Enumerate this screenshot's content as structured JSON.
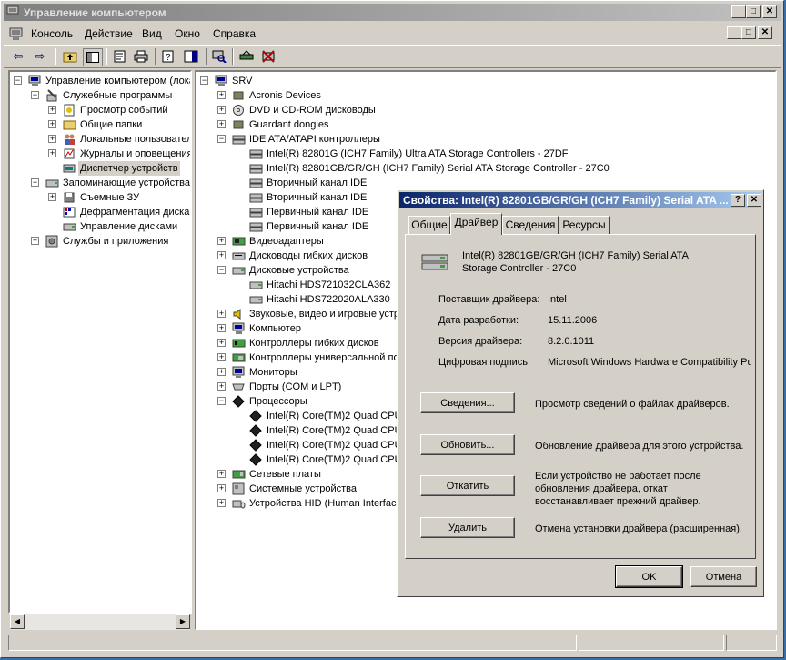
{
  "window": {
    "title": "Управление компьютером",
    "controls": {
      "minimize": "_",
      "maximize": "□",
      "close": "✕"
    }
  },
  "menubar": {
    "items": [
      "Консоль",
      "Действие",
      "Вид",
      "Окно",
      "Справка"
    ]
  },
  "left_tree": [
    {
      "label": "Управление компьютером (локаль",
      "depth": 0,
      "exp": "-",
      "icon": "computer-icon"
    },
    {
      "label": "Служебные программы",
      "depth": 1,
      "exp": "-",
      "icon": "tools-icon"
    },
    {
      "label": "Просмотр событий",
      "depth": 2,
      "exp": "+",
      "icon": "event-icon"
    },
    {
      "label": "Общие папки",
      "depth": 2,
      "exp": "+",
      "icon": "folder-icon"
    },
    {
      "label": "Локальные пользователи",
      "depth": 2,
      "exp": "+",
      "icon": "users-icon"
    },
    {
      "label": "Журналы и оповещения пр",
      "depth": 2,
      "exp": "+",
      "icon": "log-icon"
    },
    {
      "label": "Диспетчер устройств",
      "depth": 2,
      "exp": "",
      "icon": "device-manager-icon",
      "selected": true
    },
    {
      "label": "Запоминающие устройства",
      "depth": 1,
      "exp": "-",
      "icon": "storage-icon"
    },
    {
      "label": "Съемные ЗУ",
      "depth": 2,
      "exp": "+",
      "icon": "removable-icon"
    },
    {
      "label": "Дефрагментация диска",
      "depth": 2,
      "exp": "",
      "icon": "defrag-icon"
    },
    {
      "label": "Управление дисками",
      "depth": 2,
      "exp": "",
      "icon": "disk-icon"
    },
    {
      "label": "Службы и приложения",
      "depth": 1,
      "exp": "+",
      "icon": "services-icon"
    }
  ],
  "right_tree": [
    {
      "label": "SRV",
      "depth": 0,
      "exp": "-",
      "icon": "computer-icon"
    },
    {
      "label": "Acronis Devices",
      "depth": 1,
      "exp": "+",
      "icon": "device-icon"
    },
    {
      "label": "DVD и CD-ROM дисководы",
      "depth": 1,
      "exp": "+",
      "icon": "cdrom-icon"
    },
    {
      "label": "Guardant dongles",
      "depth": 1,
      "exp": "+",
      "icon": "device-icon"
    },
    {
      "label": "IDE ATA/ATAPI контроллеры",
      "depth": 1,
      "exp": "-",
      "icon": "ide-icon"
    },
    {
      "label": "Intel(R) 82801G (ICH7 Family) Ultra ATA Storage Controllers - 27DF",
      "depth": 2,
      "exp": "",
      "icon": "ide-icon"
    },
    {
      "label": "Intel(R) 82801GB/GR/GH (ICH7 Family) Serial ATA Storage Controller - 27C0",
      "depth": 2,
      "exp": "",
      "icon": "ide-icon"
    },
    {
      "label": "Вторичный канал IDE",
      "depth": 2,
      "exp": "",
      "icon": "ide-icon"
    },
    {
      "label": "Вторичный канал IDE",
      "depth": 2,
      "exp": "",
      "icon": "ide-icon"
    },
    {
      "label": "Первичный канал IDE",
      "depth": 2,
      "exp": "",
      "icon": "ide-icon"
    },
    {
      "label": "Первичный канал IDE",
      "depth": 2,
      "exp": "",
      "icon": "ide-icon"
    },
    {
      "label": "Видеоадаптеры",
      "depth": 1,
      "exp": "+",
      "icon": "display-adapter-icon"
    },
    {
      "label": "Дисководы гибких дисков",
      "depth": 1,
      "exp": "+",
      "icon": "floppy-icon"
    },
    {
      "label": "Дисковые устройства",
      "depth": 1,
      "exp": "-",
      "icon": "disk-icon"
    },
    {
      "label": "Hitachi HDS721032CLA362",
      "depth": 2,
      "exp": "",
      "icon": "disk-icon"
    },
    {
      "label": "Hitachi HDS722020ALA330",
      "depth": 2,
      "exp": "",
      "icon": "disk-icon"
    },
    {
      "label": "Звуковые, видео и игровые устр",
      "depth": 1,
      "exp": "+",
      "icon": "sound-icon"
    },
    {
      "label": "Компьютер",
      "depth": 1,
      "exp": "+",
      "icon": "computer-icon"
    },
    {
      "label": "Контроллеры гибких дисков",
      "depth": 1,
      "exp": "+",
      "icon": "floppy-controller-icon"
    },
    {
      "label": "Контроллеры универсальной пос",
      "depth": 1,
      "exp": "+",
      "icon": "usb-icon"
    },
    {
      "label": "Мониторы",
      "depth": 1,
      "exp": "+",
      "icon": "monitor-icon"
    },
    {
      "label": "Порты (COM и LPT)",
      "depth": 1,
      "exp": "+",
      "icon": "port-icon"
    },
    {
      "label": "Процессоры",
      "depth": 1,
      "exp": "-",
      "icon": "cpu-icon"
    },
    {
      "label": "Intel(R) Core(TM)2 Quad CPU",
      "depth": 2,
      "exp": "",
      "icon": "cpu-icon"
    },
    {
      "label": "Intel(R) Core(TM)2 Quad CPU",
      "depth": 2,
      "exp": "",
      "icon": "cpu-icon"
    },
    {
      "label": "Intel(R) Core(TM)2 Quad CPU",
      "depth": 2,
      "exp": "",
      "icon": "cpu-icon"
    },
    {
      "label": "Intel(R) Core(TM)2 Quad CPU",
      "depth": 2,
      "exp": "",
      "icon": "cpu-icon"
    },
    {
      "label": "Сетевые платы",
      "depth": 1,
      "exp": "+",
      "icon": "network-icon"
    },
    {
      "label": "Системные устройства",
      "depth": 1,
      "exp": "+",
      "icon": "system-icon"
    },
    {
      "label": "Устройства HID (Human Interface",
      "depth": 1,
      "exp": "+",
      "icon": "hid-icon"
    }
  ],
  "dialog": {
    "title": "Свойства: Intel(R) 82801GB/GR/GH (ICH7 Family) Serial ATA ...",
    "help": "?",
    "close": "✕",
    "tabs": [
      "Общие",
      "Драйвер",
      "Сведения",
      "Ресурсы"
    ],
    "device_name_line1": "Intel(R) 82801GB/GR/GH (ICH7 Family) Serial ATA",
    "device_name_line2": "Storage Controller - 27C0",
    "fields": [
      {
        "label": "Поставщик драйвера:",
        "value": "Intel"
      },
      {
        "label": "Дата разработки:",
        "value": "15.11.2006"
      },
      {
        "label": "Версия драйвера:",
        "value": "8.2.0.1011"
      },
      {
        "label": "Цифровая подпись:",
        "value": "Microsoft Windows Hardware Compatibility Publ"
      }
    ],
    "actions": [
      {
        "button": "Сведения...",
        "desc": [
          "Просмотр сведений о файлах драйверов."
        ]
      },
      {
        "button": "Обновить...",
        "desc": [
          "Обновление драйвера для этого устройства."
        ]
      },
      {
        "button": "Откатить",
        "desc": [
          "Если устройство не работает после",
          "обновления драйвера, откат",
          "восстанавливает прежний драйвер."
        ]
      },
      {
        "button": "Удалить",
        "desc": [
          "Отмена установки драйвера (расширенная)."
        ]
      }
    ],
    "ok": "OK",
    "cancel": "Отмена"
  }
}
